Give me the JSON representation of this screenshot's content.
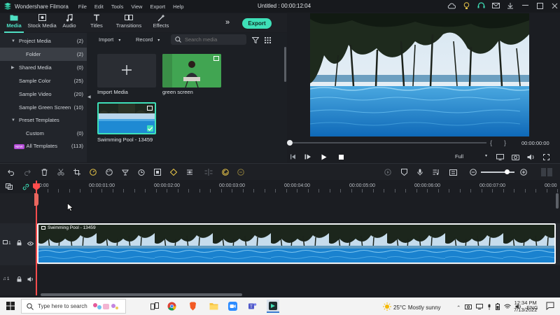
{
  "app": {
    "name": "Wondershare Filmora",
    "menu": [
      "File",
      "Edit",
      "Tools",
      "View",
      "Export",
      "Help"
    ],
    "document_title": "Untitled : 00:00:12:04"
  },
  "media_tabs": [
    {
      "label": "Media",
      "icon": "folder-icon",
      "active": true
    },
    {
      "label": "Stock Media",
      "icon": "stock-media-icon",
      "active": false
    },
    {
      "label": "Audio",
      "icon": "music-note-icon",
      "active": false
    },
    {
      "label": "Titles",
      "icon": "titles-icon",
      "active": false
    },
    {
      "label": "Transitions",
      "icon": "transitions-icon",
      "active": false
    },
    {
      "label": "Effects",
      "icon": "effects-icon",
      "active": false
    }
  ],
  "export_label": "Export",
  "sidebar": {
    "items": [
      {
        "label": "Project Media",
        "count": "(2)"
      },
      {
        "label": "Folder",
        "count": "(2)"
      },
      {
        "label": "Shared Media",
        "count": "(0)"
      },
      {
        "label": "Sample Color",
        "count": "(25)"
      },
      {
        "label": "Sample Video",
        "count": "(20)"
      },
      {
        "label": "Sample Green Screen",
        "count": "(10)"
      },
      {
        "label": "Preset Templates",
        "count": ""
      },
      {
        "label": "Custom",
        "count": "(0)"
      },
      {
        "label": "All Templates",
        "count": "(113)"
      }
    ],
    "new_badge": "NEW"
  },
  "media_toolbar": {
    "import_label": "Import",
    "record_label": "Record",
    "search_placeholder": "Search media"
  },
  "media_items": [
    {
      "label": "Import Media"
    },
    {
      "label": "green screen"
    },
    {
      "label": "Swimming Pool - 13459"
    }
  ],
  "preview": {
    "timecode": "00:00:00:00",
    "brace_open": "{",
    "brace_close": "}",
    "quality": "Full"
  },
  "ruler_labels": [
    "00:00",
    "00:00:01:00",
    "00:00:02:00",
    "00:00:03:00",
    "00:00:04:00",
    "00:00:05:00",
    "00:00:06:00",
    "00:00:07:00",
    "00:00"
  ],
  "timeline": {
    "clip_label": "Swimming Pool - 13459",
    "video_track": "1",
    "audio_track": "1"
  },
  "taskbar": {
    "search_placeholder": "Type here to search",
    "temperature": "25°C",
    "weather": "Mostly sunny",
    "language": "ENG",
    "time": "12:34 PM",
    "date": "7/13/2022"
  },
  "colors": {
    "accent": "#3ee0b8",
    "playhead": "#ff4d4d",
    "background": "#1b1d22"
  }
}
